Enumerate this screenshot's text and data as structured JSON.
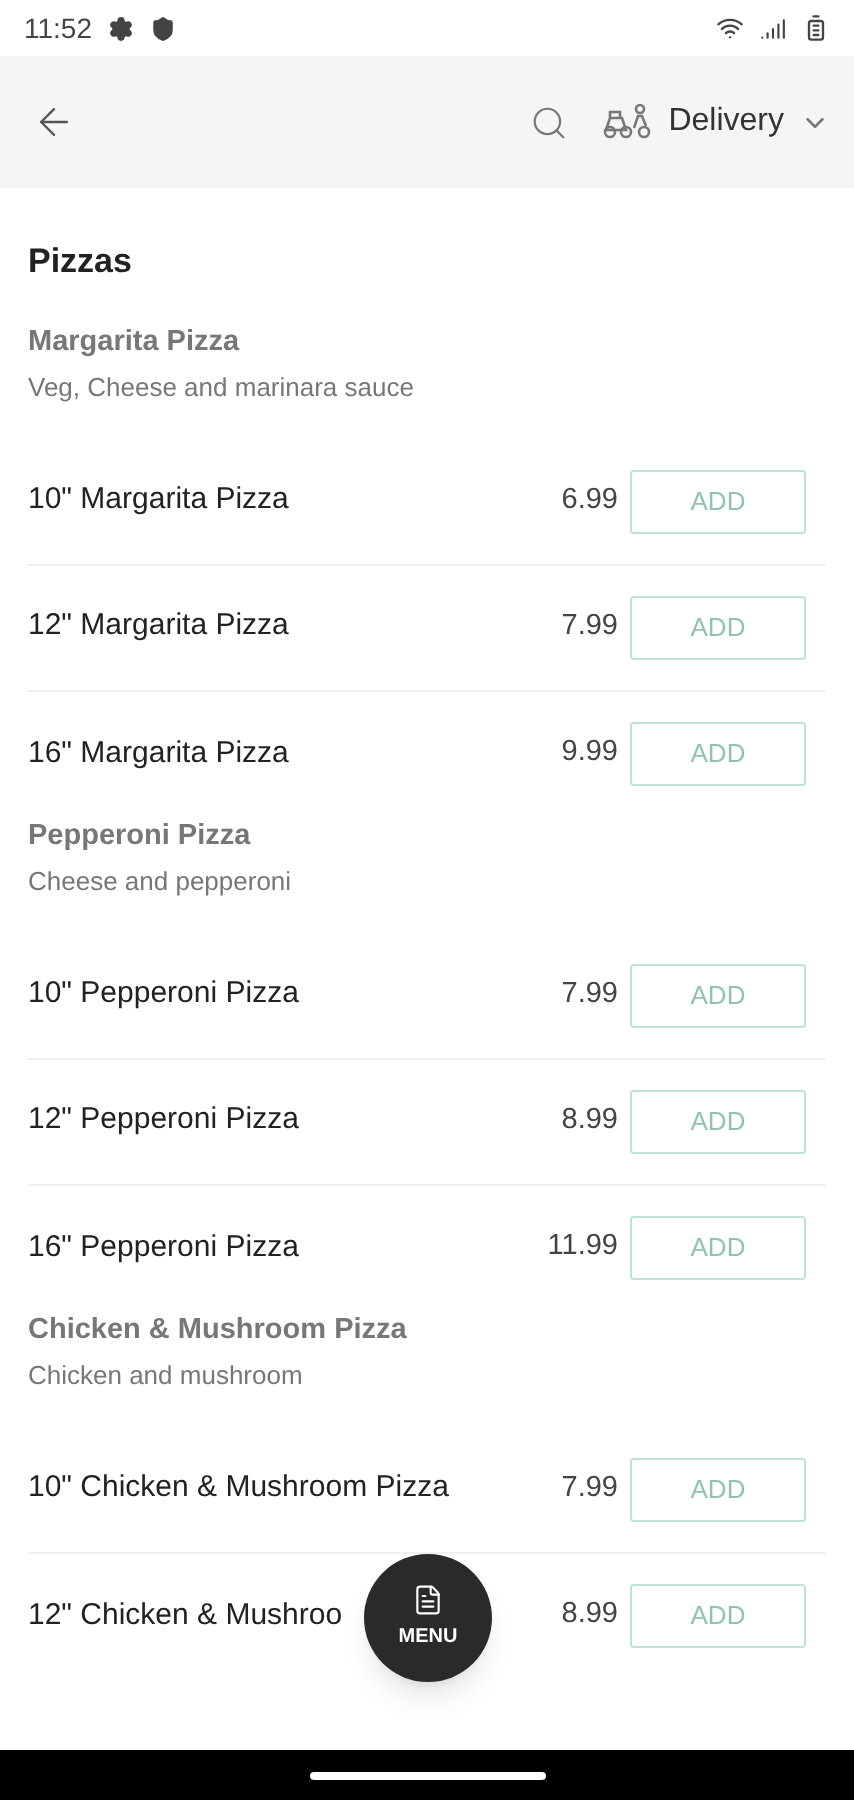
{
  "status_bar": {
    "time": "11:52"
  },
  "header": {
    "mode": "Delivery"
  },
  "section": {
    "title": "Pizzas"
  },
  "groups": [
    {
      "title": "Margarita Pizza",
      "description": "Veg, Cheese and marinara sauce",
      "items": [
        {
          "name": "10\" Margarita Pizza",
          "price": "6.99",
          "button": "ADD"
        },
        {
          "name": "12\" Margarita Pizza",
          "price": "7.99",
          "button": "ADD"
        },
        {
          "name": "16\" Margarita Pizza",
          "price": "9.99",
          "button": "ADD"
        }
      ]
    },
    {
      "title": "Pepperoni Pizza",
      "description": "Cheese and pepperoni",
      "items": [
        {
          "name": "10\" Pepperoni Pizza",
          "price": "7.99",
          "button": "ADD"
        },
        {
          "name": "12\" Pepperoni Pizza",
          "price": "8.99",
          "button": "ADD"
        },
        {
          "name": "16\" Pepperoni Pizza",
          "price": "11.99",
          "button": "ADD"
        }
      ]
    },
    {
      "title": "Chicken & Mushroom Pizza",
      "description": "Chicken and mushroom",
      "items": [
        {
          "name": "10\" Chicken & Mushroom Pizza",
          "price": "7.99",
          "button": "ADD"
        },
        {
          "name": "12\" Chicken & Mushroo",
          "price": "8.99",
          "button": "ADD"
        }
      ]
    }
  ],
  "fab": {
    "label": "MENU"
  }
}
